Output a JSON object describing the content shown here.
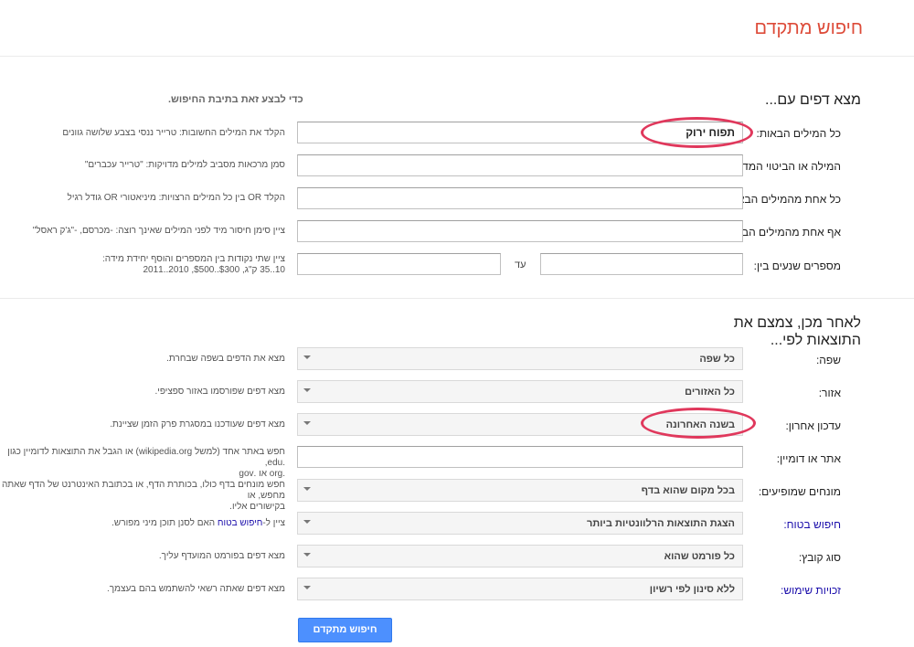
{
  "page_title": "חיפוש מתקדם",
  "section1": {
    "title": "מצא דפים עם...",
    "hint": "כדי לבצע זאת בתיבת החיפוש.",
    "rows": {
      "all_words": {
        "label": "כל המילים הבאות:",
        "value": "תפוח ירוק",
        "hint": "הקלד את המילים החשובות: טרייר ננסי בצבע שלושה גוונים"
      },
      "exact": {
        "label": "המילה או הביטוי המדויקים הבאים:",
        "value": "",
        "hint": "סמן מרכאות מסביב למילים מדויקות: \"טרייר עכברים\""
      },
      "any": {
        "label": "כל אחת מהמילים הבאות:",
        "value": "",
        "hint": "הקלד OR בין כל המילים הרצויות: מיניאטורי OR גודל רגיל"
      },
      "none": {
        "label": "אף אחת מהמילים הבאות:",
        "value": "",
        "hint": "ציין סימן חיסור מיד לפני המילים שאינך רוצה: -מכרסם, -\"ג'ק ראסל\""
      },
      "range": {
        "label": "מספרים שנעים בין:",
        "to_label": "עד",
        "value_from": "",
        "value_to": "",
        "hint_line1": "ציין שתי נקודות בין המספרים והוסף יחידת מידה:",
        "hint_line2": "10..35 ק\"ג, $300..$500, 2010..2011"
      }
    }
  },
  "section2": {
    "title_line1": "לאחר מכן, צמצם את",
    "title_line2": "התוצאות לפי...",
    "rows": {
      "language": {
        "label": "שפה:",
        "value": "כל שפה",
        "hint": "מצא את הדפים בשפה שבחרת."
      },
      "region": {
        "label": "אזור:",
        "value": "כל האזורים",
        "hint": "מצא דפים שפורסמו באזור ספציפי."
      },
      "last_update": {
        "label": "עדכון אחרון:",
        "value": "בשנה האחרונה",
        "hint": "מצא דפים שעודכנו במסגרת פרק הזמן שציינת."
      },
      "site": {
        "label": "אתר או דומיין:",
        "value": "",
        "hint_line1": "חפש באתר אחד (למשל wikipedia.org) או הגבל את התוצאות לדומיין כגון .edu,",
        "hint_line2": ".org או .gov"
      },
      "terms": {
        "label": "מונחים שמופיעים:",
        "value": "בכל מקום שהוא בדף",
        "hint_line1": "חפש מונחים בדף כולו, בכותרת הדף, או בכתובת האינטרנט של הדף שאתה מחפש, או",
        "hint_line2": "בקישורים אליו."
      },
      "safesearch": {
        "label": "חיפוש בטוח:",
        "value": "הצגת התוצאות הרלוונטיות ביותר",
        "hint_prefix": "ציין ל-",
        "hint_link": "חיפוש בטוח",
        "hint_suffix": " האם לסנן תוכן מיני מפורש."
      },
      "file_type": {
        "label": "סוג קובץ:",
        "value": "כל פורמט שהוא",
        "hint": "מצא דפים בפורמט המועדף עליך."
      },
      "usage_rights": {
        "label": "זכויות שימוש:",
        "value": "ללא סינון לפי רשיון",
        "hint": "מצא דפים שאתה רשאי להשתמש בהם בעצמך."
      }
    }
  },
  "submit_label": "חיפוש מתקדם",
  "colors": {
    "title": "#dd4b39",
    "button": "#4d90fe",
    "annotation_oval": "#e0385c",
    "link": "#1a0dab"
  }
}
